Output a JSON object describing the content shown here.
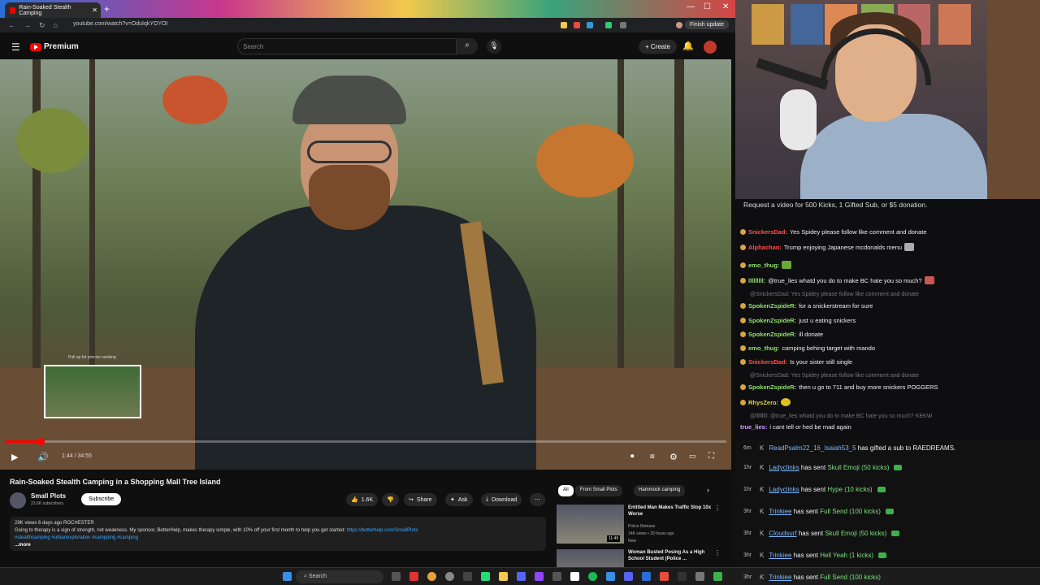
{
  "browser": {
    "tab_title": "Rain-Soaked Stealth Camping",
    "url": "youtube.com/watch?v=OduIqkYOYOI",
    "finish_update": "Finish update"
  },
  "youtube": {
    "brand": "Premium",
    "search_placeholder": "Search",
    "create_label": "Create"
  },
  "player": {
    "seek_hint": "Pull up for precise seeking",
    "time_display": "1:44 / 34:55",
    "progress_fraction": 0.05
  },
  "video": {
    "title": "Rain-Soaked Stealth Camping in a Shopping Mall Tree Island",
    "channel": "Small Plots",
    "subscribers": "23.6K subscribers",
    "subscribe_label": "Subscribe",
    "likes": "1.6K",
    "share_label": "Share",
    "ask_label": "Ask",
    "download_label": "Download",
    "views_line": "29K views  6 days ago  ROCHESTER",
    "description": "Going to therapy is a sign of strength, not weakness. My sponsor, BetterHelp, makes therapy simple, with 10% off your first month to help you get started: ",
    "description_link": "https://betterhelp.com/SmallPlots",
    "hashtags": "#stealthcamping #urbanexploration #campping #camping",
    "more_label": "...more"
  },
  "recommendations": {
    "chips": [
      "All",
      "From Small Plots",
      "Hammock camping"
    ],
    "items": [
      {
        "title": "Entitled Man Makes Traffic Stop 10x Worse",
        "channel": "Police Release",
        "meta": "14K views • 20 hours ago",
        "badge": "New",
        "duration": "11:49"
      },
      {
        "title": "Woman Busted Posing As a High School Student (Police ...",
        "channel": "",
        "meta": "",
        "badge": "",
        "duration": ""
      }
    ]
  },
  "chat": {
    "banner": "Request a video for 500 Kicks, 1 Gifted Sub, or $5 donation.",
    "messages": [
      {
        "user": "SnickersDad:",
        "text": "Yes Spidey please follow like comment and donate",
        "color": "#ff4f4f"
      },
      {
        "user": "Alphachan:",
        "text": "Trump enjoying Japanese mcdonalds menu",
        "color": "#ff4f4f"
      },
      {
        "user": "emo_thug:",
        "text": "",
        "color": "#8fe26a"
      },
      {
        "user": "lllllllll:",
        "text": "@true_lies whatd you do to make BC hate you so much?",
        "color": "#8fe26a"
      },
      {
        "reply": "@SnickersDad: Yes Spidey please follow like comment and donate"
      },
      {
        "user": "SpokenZspideR:",
        "text": "for a snickerstream for sure",
        "color": "#8fe26a"
      },
      {
        "user": "SpokenZspideR:",
        "text": "just u eating snickers",
        "color": "#8fe26a"
      },
      {
        "user": "SpokenZspideR:",
        "text": "ill donate",
        "color": "#8fe26a"
      },
      {
        "user": "emo_thug:",
        "text": "camping behing target with mando",
        "color": "#8fe26a"
      },
      {
        "user": "SnickersDad:",
        "text": "Is your sister still single",
        "color": "#ff4f4f"
      },
      {
        "reply": "@SnickersDad: Yes Spidey please follow like comment and donate"
      },
      {
        "user": "SpokenZspideR:",
        "text": "then u go to 711 and buy more snickers POGGERS",
        "color": "#8fe26a"
      },
      {
        "user": "RhysZero:",
        "text": "",
        "color": "#e0d34a"
      },
      {
        "reply": "@lllllllll: @true_lies whatd you do to make BC hate you so much? KEKW"
      },
      {
        "user": "true_lies:",
        "text": "i cant tell or hed be mad again",
        "color": "#d6a3ff"
      }
    ]
  },
  "events": [
    {
      "ago": "6m",
      "who": "ReadPsalm22_16_Isaiah53_5",
      "text": " has gifted a sub to ",
      "target": "RAEDREAMS."
    },
    {
      "ago": "1hr",
      "who": "Ladyclinks",
      "text": " has sent ",
      "amount": "Skull Emoji (50 kicks)"
    },
    {
      "ago": "1hr",
      "who": "Ladyclinks",
      "text": " has sent ",
      "amount": "Hype (10 kicks)"
    },
    {
      "ago": "3hr",
      "who": "Trinkiee",
      "text": " has sent ",
      "amount": "Full Send (100 kicks)"
    },
    {
      "ago": "3hr",
      "who": "Cloudsurf",
      "text": " has sent ",
      "amount": "Skull Emoji (50 kicks)"
    },
    {
      "ago": "3hr",
      "who": "Trinkiee",
      "text": " has sent ",
      "amount": "Hell Yeah (1 kicks)"
    },
    {
      "ago": "3hr",
      "who": "Trinkiee",
      "text": " has sent ",
      "amount": "Full Send (100 kicks)"
    }
  ],
  "taskbar": {
    "search_label": "Search"
  },
  "colors": {
    "accent": "#ff0000",
    "link": "#3ea6ff",
    "kick_green": "#3db04b"
  }
}
